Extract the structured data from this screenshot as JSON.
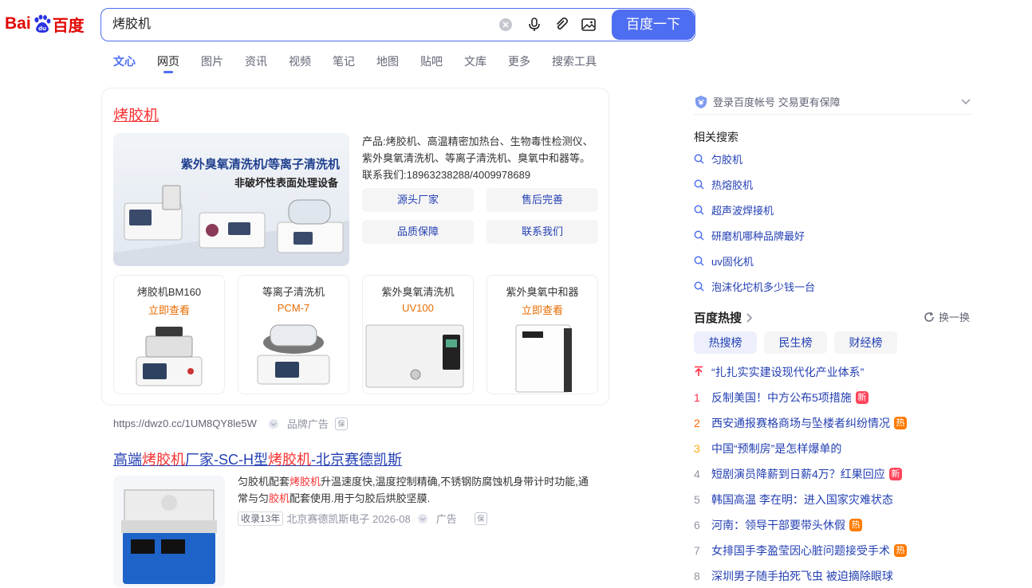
{
  "logo": {
    "bai": "Bai",
    "du": "du",
    "cn": "百度"
  },
  "search": {
    "query": "烤胶机",
    "button": "百度一下"
  },
  "tabs": [
    "文心",
    "网页",
    "图片",
    "资讯",
    "视频",
    "笔记",
    "地图",
    "贴吧",
    "文库",
    "更多",
    "搜索工具"
  ],
  "ad": {
    "title": "烤胶机",
    "banner_line1": "紫外臭氧清洗机/等离子清洗机",
    "banner_line2": "非破坏性表面处理设备",
    "desc_line1": "产品:烤胶机、高温精密加热台、生物毒性检测仪、",
    "desc_line2": "紫外臭氧清洗机、等离子清洗机、臭氧中和器等。",
    "desc_line3": "联系我们:18963238288/4009978689",
    "pills": [
      "源头厂家",
      "售后完善",
      "品质保障",
      "联系我们"
    ],
    "products": [
      {
        "name": "烤胶机BM160",
        "link": "立即查看"
      },
      {
        "name": "等离子清洗机",
        "link": "PCM-7"
      },
      {
        "name": "紫外臭氧清洗机",
        "link": "UV100"
      },
      {
        "name": "紫外臭氧中和器",
        "link": "立即查看"
      }
    ],
    "url": "https://dwz0.cc/1UM8QY8le5W",
    "brand_ad": "品牌广告",
    "bao": "保"
  },
  "result2": {
    "title_parts": [
      "高端",
      "烤胶机",
      "厂家-SC-H型",
      "烤胶机",
      "-北京赛德凯斯"
    ],
    "desc_line1_a": "匀胶机配套",
    "desc_line1_b": "烤胶机",
    "desc_line1_c": "升温速度快,温度控制精确,不锈钢防腐蚀机身带计时功能,通",
    "desc_line2_a": "常与匀",
    "desc_line2_b": "胶机",
    "desc_line2_c": "配套使用.用于匀胶后烘胶坚膜.",
    "tag": "收录13年",
    "source": "北京赛德凯斯电子 2026-08",
    "ad": "广告",
    "bao": "保"
  },
  "sidebar": {
    "login": "登录百度帐号 交易更有保障",
    "related_title": "相关搜索",
    "related": [
      "匀胶机",
      "热熔胶机",
      "超声波焊接机",
      "研磨机哪种品牌最好",
      "uv固化机",
      "泡沫化坨机多少钱一台"
    ],
    "hot_title": "百度热搜",
    "refresh": "换一换",
    "hot_tabs": [
      "热搜榜",
      "民生榜",
      "财经榜"
    ],
    "hot": [
      {
        "rank": "",
        "text": "“扎扎实实建设现代化产业体系”",
        "badge": "",
        "pinned": true
      },
      {
        "rank": "1",
        "text": "反制美国！中方公布5项措施",
        "badge": "新"
      },
      {
        "rank": "2",
        "text": "西安通报赛格商场与坠楼者纠纷情况",
        "badge": "热"
      },
      {
        "rank": "3",
        "text": "中国“预制房”是怎样爆单的",
        "badge": ""
      },
      {
        "rank": "4",
        "text": "短剧演员降薪到日薪4万？红果回应",
        "badge": "新"
      },
      {
        "rank": "5",
        "text": "韩国高温 李在明：进入国家灾难状态",
        "badge": ""
      },
      {
        "rank": "6",
        "text": "河南：领导干部要带头休假",
        "badge": "热"
      },
      {
        "rank": "7",
        "text": "女排国手李盈莹因心脏问题接受手术",
        "badge": "热"
      },
      {
        "rank": "8",
        "text": "深圳男子随手拍死飞虫 被迫摘除眼球",
        "badge": ""
      }
    ]
  }
}
